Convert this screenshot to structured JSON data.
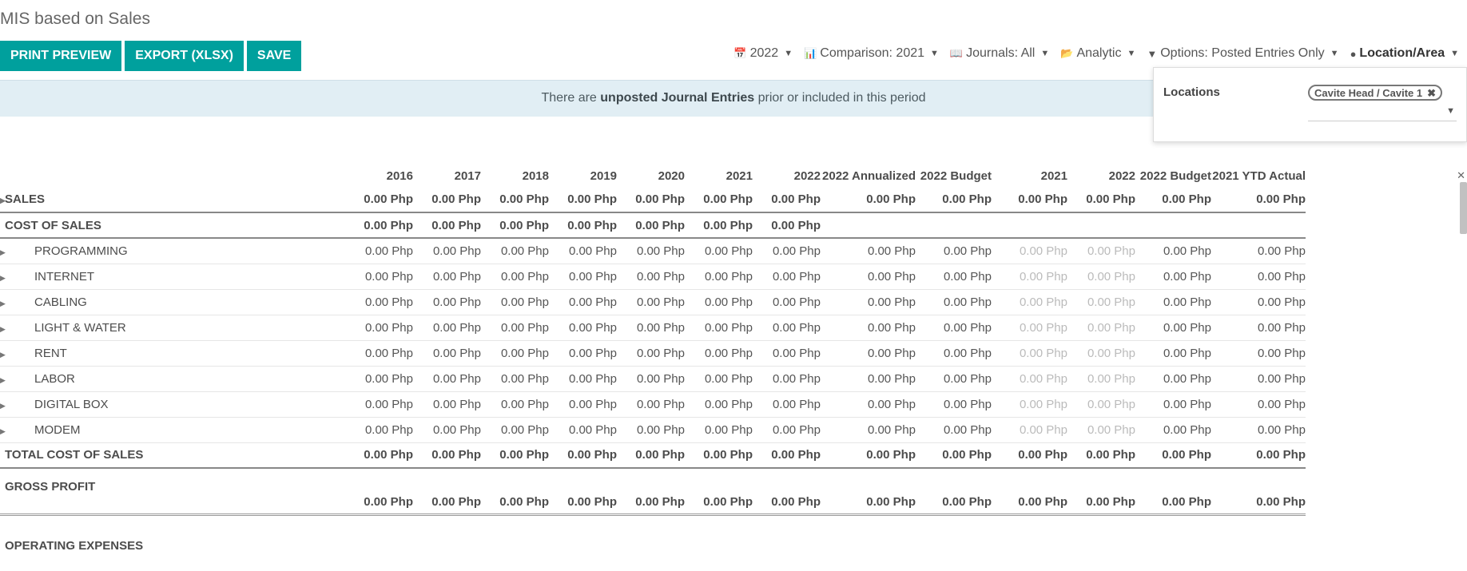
{
  "page": {
    "title": "MIS based on Sales"
  },
  "buttons": {
    "print_preview": "PRINT PREVIEW",
    "export": "EXPORT (XLSX)",
    "save": "SAVE"
  },
  "filters": {
    "year": "2022",
    "comparison": "Comparison: 2021",
    "journals": "Journals: All",
    "analytic": "Analytic",
    "options": "Options: Posted Entries Only",
    "location": "Location/Area"
  },
  "banner": {
    "pre": "There are ",
    "bold": "unposted Journal Entries",
    "post": " prior or included in this period"
  },
  "location_popup": {
    "label": "Locations",
    "tag": "Cavite Head / Cavite 1"
  },
  "table": {
    "headers": [
      "2016",
      "2017",
      "2018",
      "2019",
      "2020",
      "2021",
      "2022",
      "2022 Annualized",
      "2022 Budget",
      "2021",
      "2022",
      "2022 Budget",
      "2021 YTD Actual"
    ],
    "rows": [
      {
        "label": "SALES",
        "type": "bold",
        "arrow": true,
        "values": [
          "0.00 Php",
          "0.00 Php",
          "0.00 Php",
          "0.00 Php",
          "0.00 Php",
          "0.00 Php",
          "0.00 Php",
          "0.00 Php",
          "0.00 Php",
          "0.00 Php",
          "0.00 Php",
          "0.00 Php",
          "0.00 Php"
        ]
      },
      {
        "label": "COST OF SALES",
        "type": "bold",
        "arrow": false,
        "values": [
          "0.00 Php",
          "0.00 Php",
          "0.00 Php",
          "0.00 Php",
          "0.00 Php",
          "0.00 Php",
          "0.00 Php",
          "",
          "",
          "",
          "",
          "",
          ""
        ]
      },
      {
        "label": "PROGRAMMING",
        "type": "child",
        "values": [
          "0.00 Php",
          "0.00 Php",
          "0.00 Php",
          "0.00 Php",
          "0.00 Php",
          "0.00 Php",
          "0.00 Php",
          "0.00 Php",
          "0.00 Php",
          "0.00 Php",
          "0.00 Php",
          "0.00 Php",
          "0.00 Php"
        ]
      },
      {
        "label": "INTERNET",
        "type": "child",
        "values": [
          "0.00 Php",
          "0.00 Php",
          "0.00 Php",
          "0.00 Php",
          "0.00 Php",
          "0.00 Php",
          "0.00 Php",
          "0.00 Php",
          "0.00 Php",
          "0.00 Php",
          "0.00 Php",
          "0.00 Php",
          "0.00 Php"
        ]
      },
      {
        "label": "CABLING",
        "type": "child",
        "values": [
          "0.00 Php",
          "0.00 Php",
          "0.00 Php",
          "0.00 Php",
          "0.00 Php",
          "0.00 Php",
          "0.00 Php",
          "0.00 Php",
          "0.00 Php",
          "0.00 Php",
          "0.00 Php",
          "0.00 Php",
          "0.00 Php"
        ]
      },
      {
        "label": "LIGHT & WATER",
        "type": "child",
        "values": [
          "0.00 Php",
          "0.00 Php",
          "0.00 Php",
          "0.00 Php",
          "0.00 Php",
          "0.00 Php",
          "0.00 Php",
          "0.00 Php",
          "0.00 Php",
          "0.00 Php",
          "0.00 Php",
          "0.00 Php",
          "0.00 Php"
        ]
      },
      {
        "label": "RENT",
        "type": "child",
        "values": [
          "0.00 Php",
          "0.00 Php",
          "0.00 Php",
          "0.00 Php",
          "0.00 Php",
          "0.00 Php",
          "0.00 Php",
          "0.00 Php",
          "0.00 Php",
          "0.00 Php",
          "0.00 Php",
          "0.00 Php",
          "0.00 Php"
        ]
      },
      {
        "label": "LABOR",
        "type": "child",
        "values": [
          "0.00 Php",
          "0.00 Php",
          "0.00 Php",
          "0.00 Php",
          "0.00 Php",
          "0.00 Php",
          "0.00 Php",
          "0.00 Php",
          "0.00 Php",
          "0.00 Php",
          "0.00 Php",
          "0.00 Php",
          "0.00 Php"
        ]
      },
      {
        "label": "DIGITAL BOX",
        "type": "child",
        "values": [
          "0.00 Php",
          "0.00 Php",
          "0.00 Php",
          "0.00 Php",
          "0.00 Php",
          "0.00 Php",
          "0.00 Php",
          "0.00 Php",
          "0.00 Php",
          "0.00 Php",
          "0.00 Php",
          "0.00 Php",
          "0.00 Php"
        ]
      },
      {
        "label": "MODEM",
        "type": "child",
        "values": [
          "0.00 Php",
          "0.00 Php",
          "0.00 Php",
          "0.00 Php",
          "0.00 Php",
          "0.00 Php",
          "0.00 Php",
          "0.00 Php",
          "0.00 Php",
          "0.00 Php",
          "0.00 Php",
          "0.00 Php",
          "0.00 Php"
        ]
      },
      {
        "label": "TOTAL COST OF SALES",
        "type": "total",
        "values": [
          "0.00 Php",
          "0.00 Php",
          "0.00 Php",
          "0.00 Php",
          "0.00 Php",
          "0.00 Php",
          "0.00 Php",
          "0.00 Php",
          "0.00 Php",
          "0.00 Php",
          "0.00 Php",
          "0.00 Php",
          "0.00 Php"
        ]
      },
      {
        "label": "GROSS PROFIT",
        "type": "gross",
        "values": [
          "0.00 Php",
          "0.00 Php",
          "0.00 Php",
          "0.00 Php",
          "0.00 Php",
          "0.00 Php",
          "0.00 Php",
          "0.00 Php",
          "0.00 Php",
          "0.00 Php",
          "0.00 Php",
          "0.00 Php",
          "0.00 Php"
        ]
      },
      {
        "label": "OPERATING EXPENSES",
        "type": "section",
        "values": []
      }
    ]
  },
  "colors": {
    "accent": "#00a09d",
    "banner_bg": "#e1eef4",
    "dim_value": "#bbbbbb"
  }
}
